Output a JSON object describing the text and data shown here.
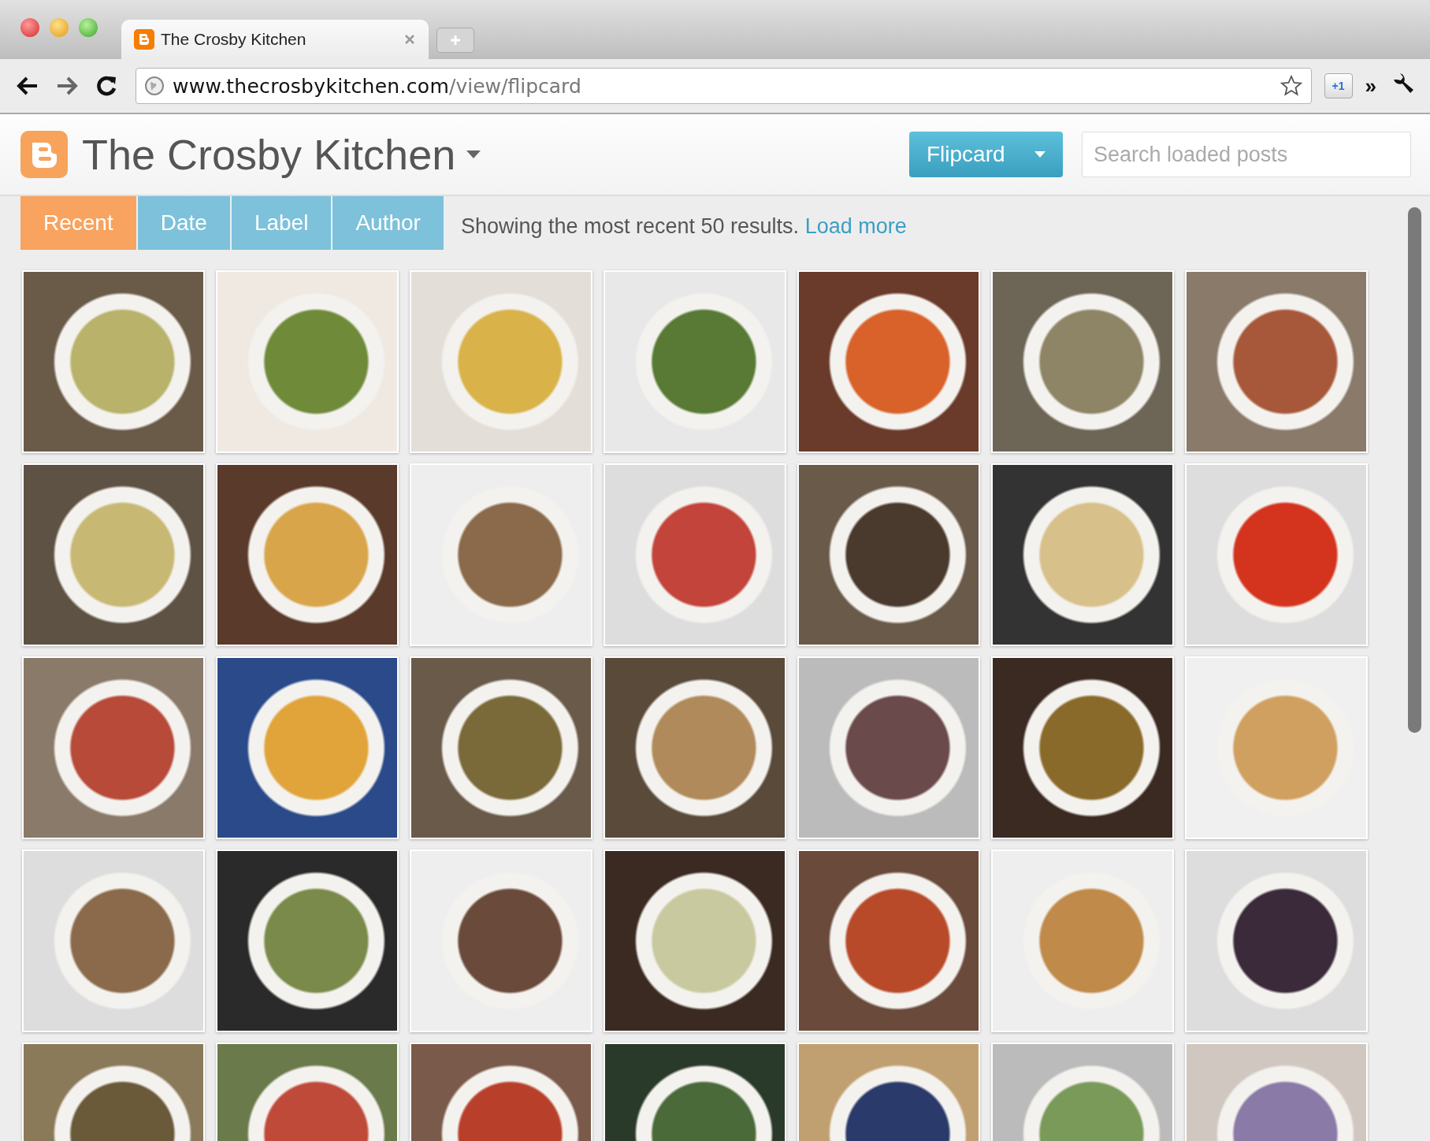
{
  "window": {
    "tab_title": "The Crosby Kitchen"
  },
  "toolbar": {
    "url_host": "www.thecrosbykitchen.com",
    "url_path": "/view/flipcard",
    "extension_badge": "+1",
    "overflow_chevron": "»"
  },
  "blog": {
    "title": "The Crosby Kitchen",
    "view_button": "Flipcard",
    "search": {
      "placeholder": "Search loaded posts"
    }
  },
  "tabs": [
    {
      "label": "Recent",
      "selected": true
    },
    {
      "label": "Date",
      "selected": false
    },
    {
      "label": "Label",
      "selected": false
    },
    {
      "label": "Author",
      "selected": false
    }
  ],
  "status": {
    "text": "Showing the most recent 50 results.",
    "link": "Load more"
  }
}
